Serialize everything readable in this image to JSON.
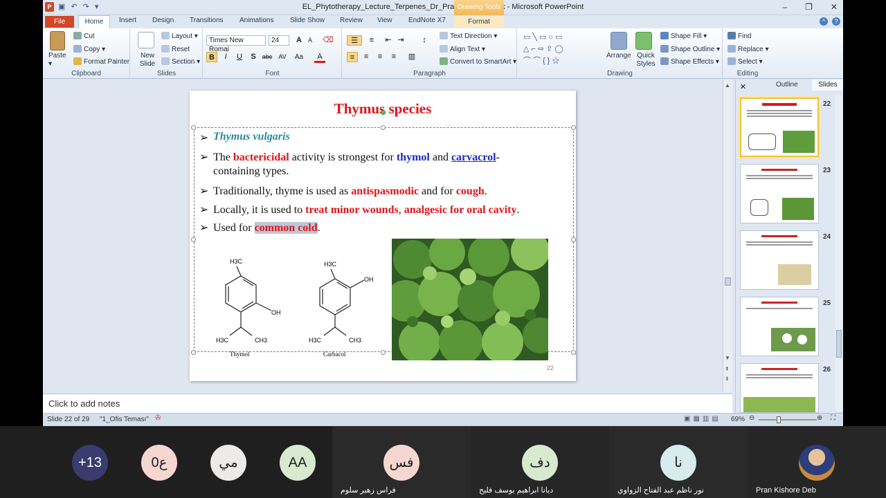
{
  "window": {
    "title": "EL_Phytotherapy_Lecture_Terpenes_Dr_Pran_Kishore.pptx - Microsoft PowerPoint",
    "contextual_tab": "Drawing Tools",
    "minimize": "–",
    "maximize": "❐",
    "close": "✕"
  },
  "tabs": [
    "File",
    "Home",
    "Insert",
    "Design",
    "Transitions",
    "Animations",
    "Slide Show",
    "Review",
    "View",
    "EndNote X7",
    "Format"
  ],
  "ribbon": {
    "clipboard": {
      "paste": "Paste",
      "cut": "Cut",
      "copy": "Copy",
      "format_painter": "Format Painter",
      "name": "Clipboard"
    },
    "slides": {
      "new_slide": "New Slide",
      "layout": "Layout",
      "reset": "Reset",
      "section": "Section",
      "name": "Slides"
    },
    "font": {
      "family": "Times New Romai",
      "size": "24",
      "bold": "B",
      "italic": "I",
      "underline": "U",
      "shadow": "S",
      "strike": "abc",
      "spacing": "AV",
      "case": "Aa",
      "color": "A",
      "grow": "A",
      "shrink": "A",
      "name": "Font"
    },
    "paragraph": {
      "text_direction": "Text Direction",
      "align_text": "Align Text",
      "smartart": "Convert to SmartArt",
      "name": "Paragraph"
    },
    "drawing": {
      "arrange": "Arrange",
      "quick_styles": "Quick Styles",
      "shape_fill": "Shape Fill",
      "shape_outline": "Shape Outline",
      "shape_effects": "Shape Effects",
      "name": "Drawing"
    },
    "editing": {
      "find": "Find",
      "replace": "Replace",
      "select": "Select",
      "name": "Editing"
    }
  },
  "slide": {
    "title": "Thymus species",
    "subtitle": "Thymus vulgaris",
    "b1_pre": "The ",
    "b1_red": "bactericidal",
    "b1_mid": " activity is strongest for ",
    "b1_blue1": "thymol",
    "b1_and": " and ",
    "b1_blue2": "carvacrol",
    "b1_dash": "-",
    "b1_line2": "containing types.",
    "b2_pre": "Traditionally, thyme is used as ",
    "b2_red1": "antispasmodic",
    "b2_mid": " and for ",
    "b2_red2": "cough",
    "b2_end": ".",
    "b3_pre": "Locally, it is used to ",
    "b3_red1": "treat minor wounds",
    "b3_comma": ", ",
    "b3_red2": "analgesic for oral cavity",
    "b3_end": ".",
    "b4_pre": "Used for ",
    "b4_red": "common cold",
    "b4_end": ".",
    "chem1_label": "Thymol",
    "chem2_label": "Carbacol",
    "chem_ch3": "H3C",
    "chem_oh": "OH",
    "chem_ch3b": "CH3",
    "page_number": "22"
  },
  "notes_placeholder": "Click to add notes",
  "panel": {
    "outline_tab": "Outline",
    "slides_tab": "Slides",
    "close": "✕",
    "thumbs": [
      "22",
      "23",
      "24",
      "25",
      "26"
    ]
  },
  "status": {
    "slide_info": "Slide 22 of 29",
    "theme": "\"1_Ofis Teması\"",
    "zoom": "69%"
  },
  "participants": [
    {
      "initials": "+13",
      "name": "",
      "color": "#3a3b6e"
    },
    {
      "initials": "ع0",
      "name": "",
      "color": "#f6d6d0"
    },
    {
      "initials": "مي",
      "name": "",
      "color": "#ecebea"
    },
    {
      "initials": "AA",
      "name": "",
      "color": "#d7ead0"
    },
    {
      "initials": "فس",
      "name": "فراس زهير سلوم",
      "color": "#f6d6d0"
    },
    {
      "initials": "دف",
      "name": "ديانا ابراهيم يوسف فليح",
      "color": "#d7ead0"
    },
    {
      "initials": "نا",
      "name": "نور ناظم عبد الفتاح الزواوي",
      "color": "#d6ecef"
    },
    {
      "initials": "",
      "name": "Pran Kishore Deb",
      "color": "#7a5a3c"
    }
  ]
}
